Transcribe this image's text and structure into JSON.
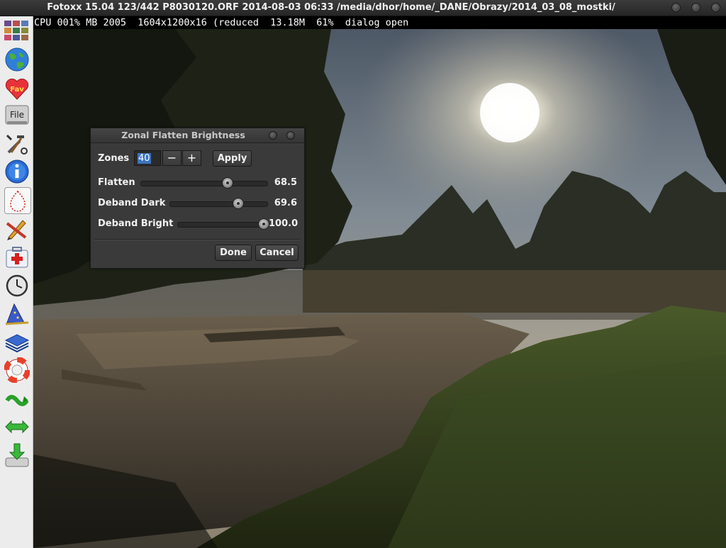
{
  "window": {
    "title": "Fotoxx 15.04  123/442  P8030120.ORF  2014-08-03 06:33  /media/dhor/home/_DANE/Obrazy/2014_03_08_mostki/"
  },
  "status_line": "CPU 001% MB 2005  1604x1200x16 (reduced  13.18M  61%  dialog open",
  "toolbar": {
    "items": [
      {
        "name": "thumbnails-icon"
      },
      {
        "name": "globe-icon"
      },
      {
        "name": "favorites-icon",
        "label": "Fav"
      },
      {
        "name": "file-icon",
        "label": "File"
      },
      {
        "name": "tools-icon"
      },
      {
        "name": "info-icon"
      },
      {
        "name": "select-area-icon"
      },
      {
        "name": "edit-brush-icon"
      },
      {
        "name": "repair-kit-icon"
      },
      {
        "name": "clock-icon"
      },
      {
        "name": "wizard-icon"
      },
      {
        "name": "layers-icon"
      },
      {
        "name": "help-lifebuoy-icon"
      },
      {
        "name": "undo-redo-icon"
      },
      {
        "name": "resize-arrows-icon"
      },
      {
        "name": "save-download-icon"
      }
    ]
  },
  "dialog": {
    "title": "Zonal Flatten Brightness",
    "zones_label": "Zones",
    "zones_value": "40",
    "minus_label": "−",
    "plus_label": "+",
    "apply_label": "Apply",
    "sliders": [
      {
        "label": "Flatten",
        "value": 68.5,
        "display": "68.5"
      },
      {
        "label": "Deband Dark",
        "value": 69.6,
        "display": "69.6"
      },
      {
        "label": "Deband Bright",
        "value": 100.0,
        "display": "100.0"
      }
    ],
    "done_label": "Done",
    "cancel_label": "Cancel"
  }
}
